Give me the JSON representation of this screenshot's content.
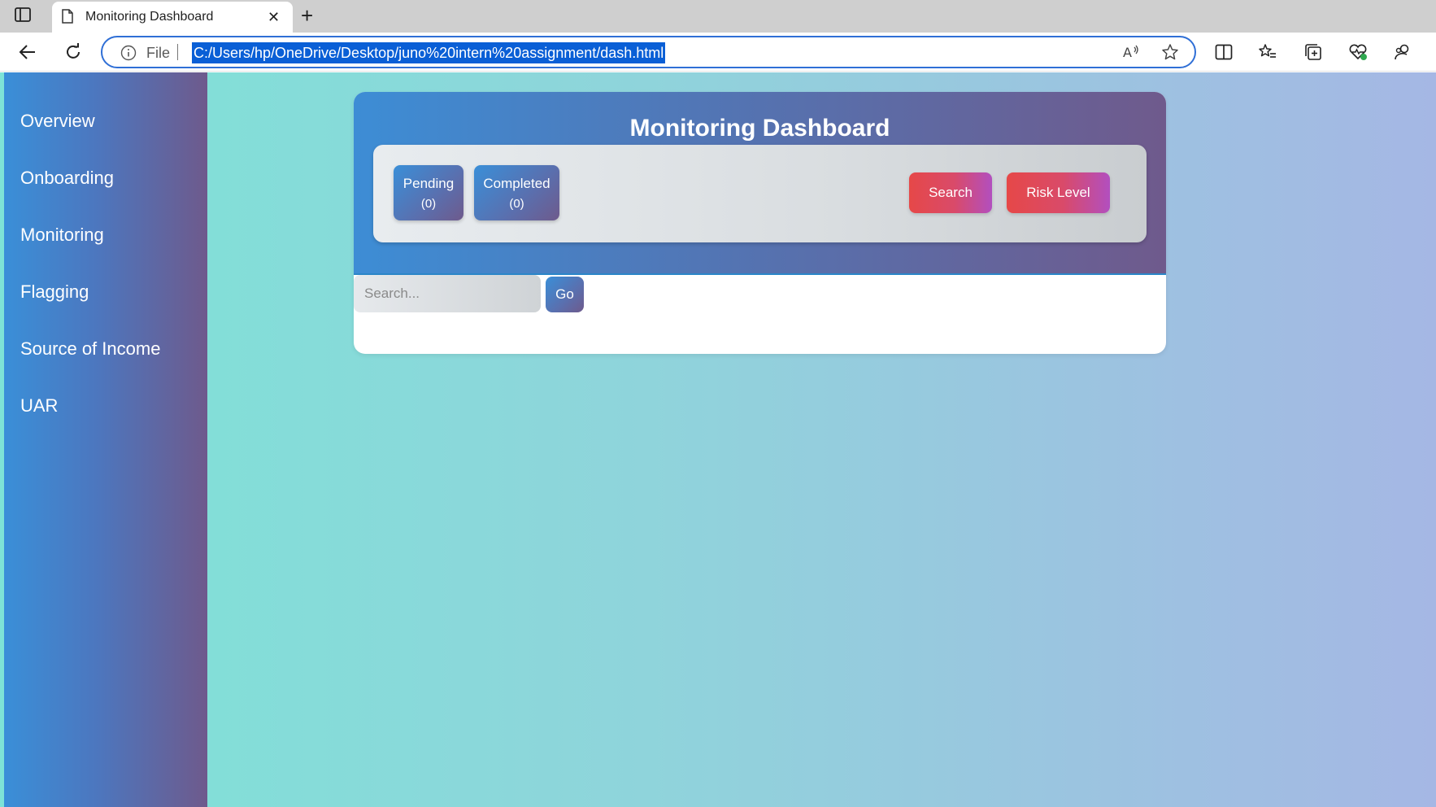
{
  "browser": {
    "tab_title": "Monitoring Dashboard",
    "tab_close": "✕",
    "new_tab": "+",
    "address_prefix": "File",
    "url": "C:/Users/hp/OneDrive/Desktop/juno%20intern%20assignment/dash.html",
    "icons": [
      "tab-actions-icon",
      "page-icon",
      "back-icon",
      "reload-icon",
      "info-icon",
      "read-aloud-icon",
      "favorite-star-icon",
      "split-screen-icon",
      "favorites-icon",
      "collections-icon",
      "browser-essentials-icon",
      "copilot-icon"
    ]
  },
  "sidebar": {
    "items": [
      {
        "label": "Overview"
      },
      {
        "label": "Onboarding"
      },
      {
        "label": "Monitoring"
      },
      {
        "label": "Flagging"
      },
      {
        "label": "Source of Income"
      },
      {
        "label": "UAR"
      }
    ]
  },
  "dashboard": {
    "title": "Monitoring Dashboard",
    "pending": {
      "label": "Pending",
      "count": "(0)"
    },
    "completed": {
      "label": "Completed",
      "count": "(0)"
    },
    "search_button": "Search",
    "risk_button": "Risk Level",
    "search_placeholder": "Search...",
    "go_button": "Go"
  },
  "colors": {
    "sidebar_start": "#3a8fd8",
    "sidebar_end": "#6e5a8c",
    "background_start": "#7de3d7",
    "background_end": "#a5b7e4",
    "action_start": "#e64848",
    "action_end": "#b24fbf"
  }
}
